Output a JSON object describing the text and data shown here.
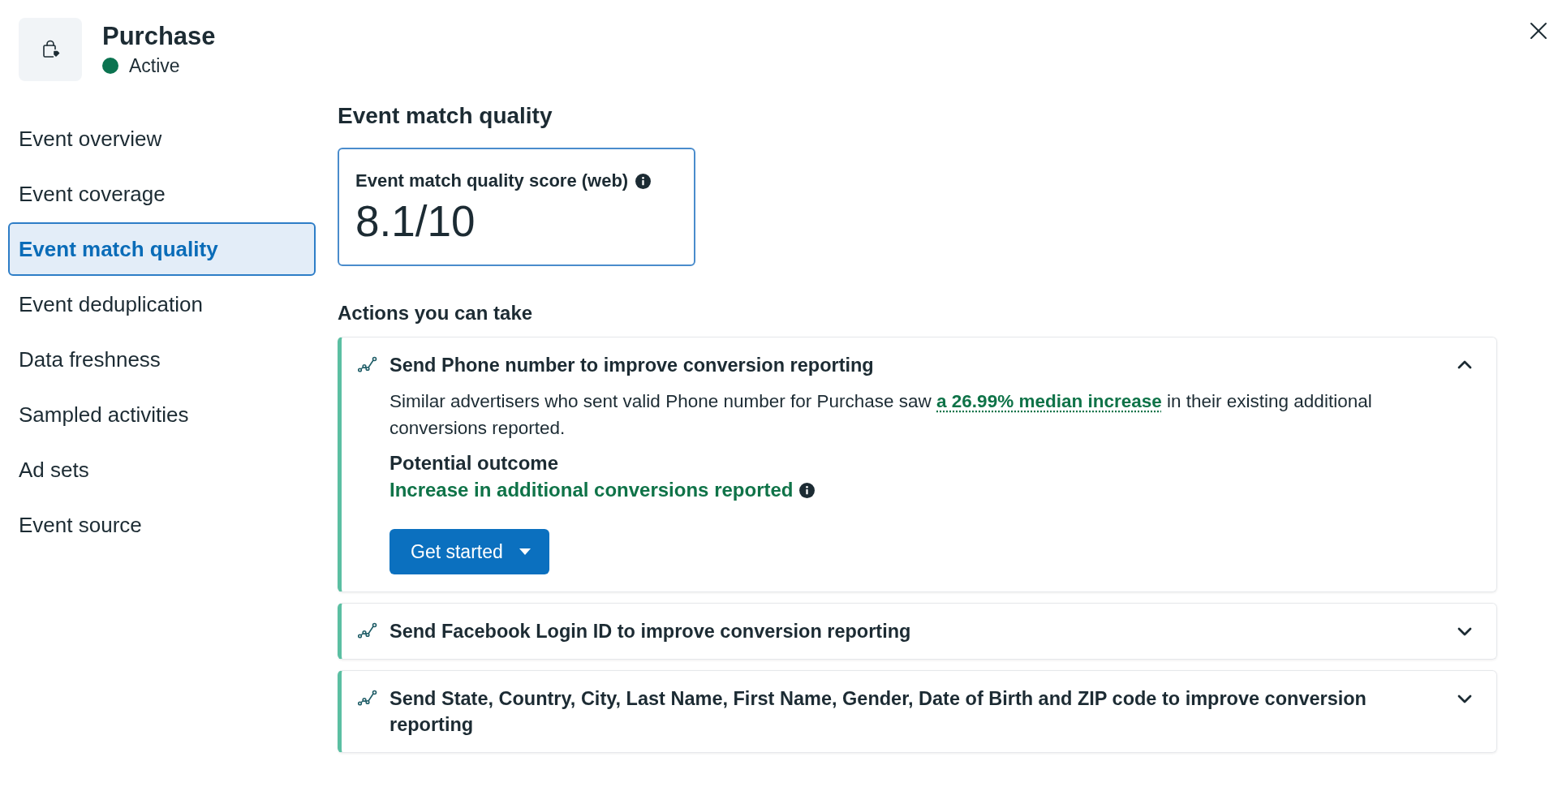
{
  "header": {
    "title": "Purchase",
    "status": {
      "label": "Active",
      "active": true
    }
  },
  "sidebar": {
    "items": [
      {
        "label": "Event overview",
        "selected": false
      },
      {
        "label": "Event coverage",
        "selected": false
      },
      {
        "label": "Event match quality",
        "selected": true
      },
      {
        "label": "Event deduplication",
        "selected": false
      },
      {
        "label": "Data freshness",
        "selected": false
      },
      {
        "label": "Sampled activities",
        "selected": false
      },
      {
        "label": "Ad sets",
        "selected": false
      },
      {
        "label": "Event source",
        "selected": false
      }
    ]
  },
  "section": {
    "title": "Event match quality"
  },
  "score_card": {
    "label": "Event match quality score (web)",
    "value": "8.1/10"
  },
  "actions": {
    "title": "Actions you can take",
    "items": [
      {
        "title": "Send Phone number to improve conversion reporting",
        "expanded": true,
        "description_start": "Similar advertisers who sent valid Phone number for Purchase saw",
        "description_link": "a 26.99% median increase",
        "description_end": "in their existing additional conversions reported.",
        "outcome_label": "Potential outcome",
        "outcome": "Increase in additional conversions reported",
        "button": "Get started"
      },
      {
        "title": "Send Facebook Login ID to improve conversion reporting",
        "expanded": false
      },
      {
        "title": "Send State, Country, City, Last Name, First Name, Gender, Date of Birth and ZIP code to improve conversion reporting",
        "expanded": false
      }
    ]
  }
}
